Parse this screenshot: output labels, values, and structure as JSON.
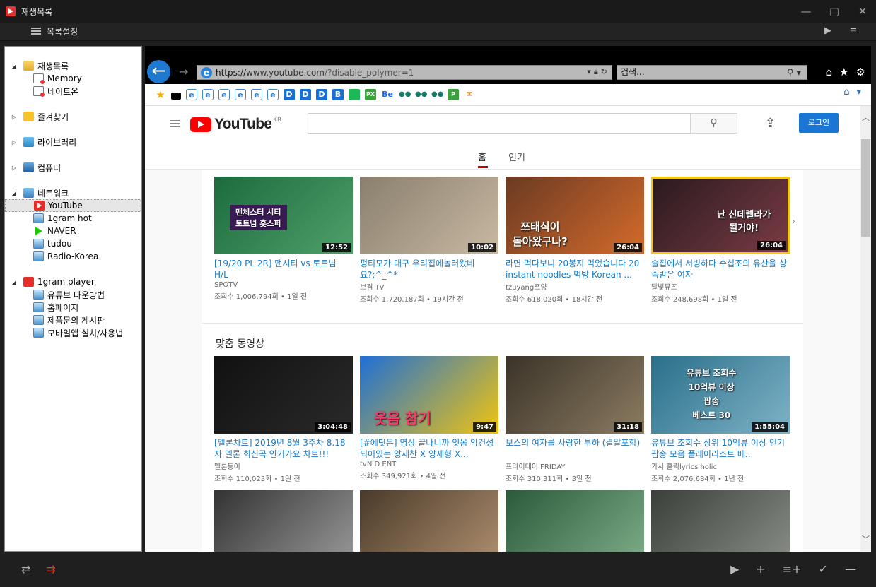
{
  "window": {
    "title": "재생목록",
    "controls": [
      "minimize",
      "maximize",
      "close"
    ]
  },
  "toolbar": {
    "list_settings_label": "목록설정"
  },
  "tree": {
    "items": [
      {
        "label": "재생목록",
        "level": 0,
        "icon": "folder-icon",
        "expanded": true
      },
      {
        "label": "Memory",
        "level": 1,
        "icon": "memory-icon"
      },
      {
        "label": "네이트온",
        "level": 1,
        "icon": "memory-icon"
      },
      {
        "label": "즐겨찾기",
        "level": 0,
        "icon": "star-folder-icon",
        "expanded": false
      },
      {
        "label": "라이브러리",
        "level": 0,
        "icon": "library-icon",
        "expanded": false
      },
      {
        "label": "컴퓨터",
        "level": 0,
        "icon": "computer-icon",
        "expanded": false
      },
      {
        "label": "네트워크",
        "level": 0,
        "icon": "network-icon",
        "expanded": true
      },
      {
        "label": "YouTube",
        "level": 1,
        "icon": "youtube-icon",
        "selected": true
      },
      {
        "label": "1gram hot",
        "level": 1,
        "icon": "web-icon"
      },
      {
        "label": "NAVER",
        "level": 1,
        "icon": "naver-icon"
      },
      {
        "label": "tudou",
        "level": 1,
        "icon": "web-icon"
      },
      {
        "label": "Radio-Korea",
        "level": 1,
        "icon": "web-icon"
      },
      {
        "label": "1gram player",
        "level": 0,
        "icon": "player-icon",
        "expanded": true
      },
      {
        "label": "유튜브 다운방법",
        "level": 1,
        "icon": "web-icon"
      },
      {
        "label": "홈페이지",
        "level": 1,
        "icon": "web-icon"
      },
      {
        "label": "제품문의 게시판",
        "level": 1,
        "icon": "web-icon"
      },
      {
        "label": "모바일앱 설치/사용법",
        "level": 1,
        "icon": "web-icon"
      }
    ]
  },
  "browser": {
    "url_scheme": "https://",
    "url_host": "www.youtube.com",
    "url_path": "/?disable_polymer=1",
    "search_placeholder": "검색..."
  },
  "favorites": [
    {
      "type": "star"
    },
    {
      "type": "black"
    },
    {
      "type": "ie",
      "text": "e"
    },
    {
      "type": "ie",
      "text": "e"
    },
    {
      "type": "ie",
      "text": "e"
    },
    {
      "type": "ie",
      "text": "e"
    },
    {
      "type": "ie",
      "text": "e"
    },
    {
      "type": "ie",
      "text": "e"
    },
    {
      "type": "d",
      "text": "D"
    },
    {
      "type": "d",
      "text": "D"
    },
    {
      "type": "d",
      "text": "D"
    },
    {
      "type": "b",
      "text": "B"
    },
    {
      "type": "g",
      "text": ""
    },
    {
      "type": "px",
      "text": "PX"
    },
    {
      "type": "be",
      "text": "Be"
    },
    {
      "type": "tb",
      "text": "●●"
    },
    {
      "type": "tb",
      "text": "●●"
    },
    {
      "type": "tb",
      "text": "●●"
    },
    {
      "type": "px",
      "text": "P"
    },
    {
      "type": "m",
      "text": "✉"
    }
  ],
  "youtube": {
    "logo_text": "YouTube",
    "region": "KR",
    "login_label": "로그인",
    "tabs": [
      "홈",
      "인기"
    ],
    "shelf_title": "맞춤 동영상",
    "trending": [
      {
        "title": "[19/20 PL 2R] 맨시티 vs 토트넘 H/L",
        "channel": "SPOTV",
        "views": "조회수 1,006,794회",
        "age": "1일 전",
        "duration": "12:52",
        "thumb_text": "맨체스터 시티\n토트넘 홋스퍼",
        "colors": [
          "#1c6b3e",
          "#4fa06a"
        ]
      },
      {
        "title": "펑티모가 대구 우리집에놀러왔네요?;^_^*",
        "channel": "보겸 TV",
        "views": "조회수 1,720,187회",
        "age": "19시간 전",
        "duration": "10:02",
        "thumb_text": "",
        "colors": [
          "#8a7f6e",
          "#c8b9a2"
        ]
      },
      {
        "title": "라면 먹다보니 20봉지 먹었습니다 20 instant noodles 먹방 Korean ...",
        "channel": "tzuyang쯔양",
        "views": "조회수 618,020회",
        "age": "18시간 전",
        "duration": "26:04",
        "thumb_text": "쯔태식이\n돌아왔구나?",
        "colors": [
          "#6b3a22",
          "#d46b2b"
        ]
      },
      {
        "title": "술집에서 서빙하다 수십조의 유산을 상속받은 여자",
        "channel": "달빛뮤즈",
        "views": "조회수 248,698회",
        "age": "1일 전",
        "duration": "26:04",
        "thumb_text": "난 신데렐라가\n될거야!",
        "colors": [
          "#2a1a1f",
          "#7a3b44"
        ]
      }
    ],
    "recommended": [
      {
        "title": "[멜론차트] 2019년 8월 3주차 8.18자 멜론 최신곡 인기가요 차트!!!",
        "channel": "멜론등이",
        "views": "조회수 110,023회",
        "age": "1일 전",
        "duration": "3:04:48",
        "thumb_text": "",
        "colors": [
          "#111111",
          "#2a2a2a"
        ]
      },
      {
        "title": "[#에딧몬] 영상 끝나니까 잇몸 악건성 되어있는 양세찬 X 양세형 X...",
        "channel": "tvN D ENT",
        "views": "조회수 349,921회",
        "age": "4일 전",
        "duration": "9:47",
        "thumb_text": "웃음 참기",
        "colors": [
          "#1e6fd6",
          "#f1c40f"
        ]
      },
      {
        "title": "보스의 여자를 사랑한 부하 (결말포함)",
        "channel": "프라이데이 FRIDAY",
        "views": "조회수 310,311회",
        "age": "3일 전",
        "duration": "31:18",
        "thumb_text": "",
        "colors": [
          "#3a3328",
          "#8c7c62"
        ]
      },
      {
        "title": "유튜브 조회수 상위 10억뷰 이상 인기 팝송 모음 플레이리스트 베...",
        "channel": "가사 훌릭lyrics holic",
        "views": "조회수 2,076,684회",
        "age": "1년 전",
        "duration": "1:55:04",
        "thumb_text": "유튜브 조회수\n10억뷰 이상\n팝송\n베스트 30",
        "colors": [
          "#2a6f8a",
          "#7fb3c7"
        ]
      }
    ],
    "third_row_colors": [
      [
        "#333333",
        "#9a9a9a"
      ],
      [
        "#4a3a2a",
        "#b09070"
      ],
      [
        "#2a5a3a",
        "#7fae8a"
      ],
      [
        "#3a3f3a",
        "#8a8f88"
      ]
    ]
  },
  "bottombar": {
    "left_icons": [
      "repeat-icon",
      "shuffle-icon"
    ],
    "right_icons": [
      "play-icon",
      "add-icon",
      "add-list-icon",
      "check-icon",
      "remove-icon"
    ]
  }
}
